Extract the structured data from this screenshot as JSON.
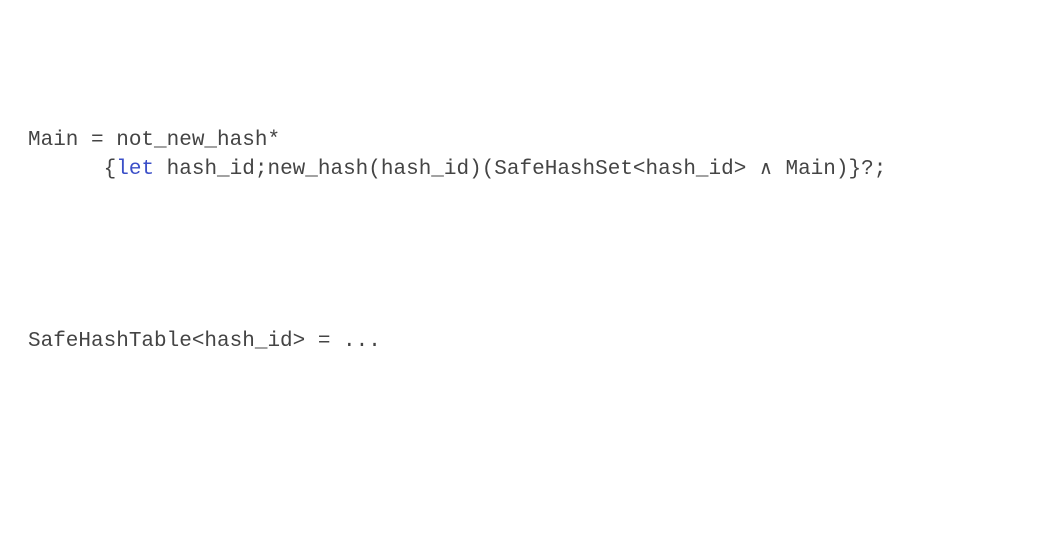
{
  "grammar": {
    "main_rule": {
      "line1": "Main = not_new_hash*",
      "line2_indent": "      ",
      "line2_open": "{",
      "line2_keyword": "let",
      "line2_rest_a": " hash_id;new_hash(hash_id)(SafeHashSet<hash_id> ",
      "line2_and": "∧",
      "line2_rest_b": " Main)}?;"
    },
    "table_rule": {
      "text": "SafeHashTable<hash_id> = ..."
    }
  },
  "colors": {
    "text": "#444444",
    "keyword": "#3b4fc8",
    "background": "#ffffff"
  }
}
